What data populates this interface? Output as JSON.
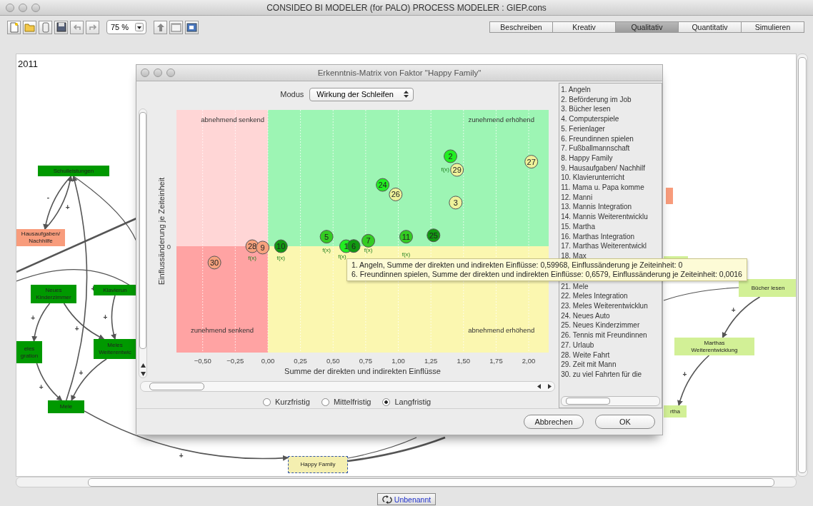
{
  "window": {
    "title": "CONSIDEO BI MODELER (for PALO) PROCESS MODELER : GIEP.cons"
  },
  "toolbar": {
    "zoom": "75 %",
    "tabs": [
      {
        "label": "Beschreiben",
        "selected": false
      },
      {
        "label": "Kreativ",
        "selected": false
      },
      {
        "label": "Qualitativ",
        "selected": true
      },
      {
        "label": "Quantitativ",
        "selected": false
      },
      {
        "label": "Simulieren",
        "selected": false
      }
    ]
  },
  "canvas": {
    "year": "2011",
    "nodes": [
      {
        "label": "Schulleistungen",
        "color": "#009900",
        "selected": false
      },
      {
        "label": "Hausaufgaben/\nNachhilfe",
        "color": "#f89c7c",
        "selected": false
      },
      {
        "label": "Neues\nKinderzimmer",
        "color": "#009900",
        "selected": false
      },
      {
        "label": "Klavierun",
        "color": "#009900",
        "selected": false
      },
      {
        "label": "eles\ngration",
        "color": "#009900",
        "selected": false
      },
      {
        "label": "Meles\nWeiterentwic",
        "color": "#009900",
        "selected": false
      },
      {
        "label": "Mele",
        "color": "#009900",
        "selected": false
      },
      {
        "label": "Happy Family",
        "color": "#f4efb0",
        "selected": true
      },
      {
        "label": "Bücher lesen",
        "color": "#d2f096",
        "selected": false
      },
      {
        "label": "Marthas\nWeiterentwicklung",
        "color": "#d2f096",
        "selected": false
      },
      {
        "label": "rtha",
        "color": "#d2f096",
        "selected": false
      },
      {
        "color": "#f89c7c",
        "selected": false
      },
      {
        "color": "#d2f096",
        "selected": false
      }
    ],
    "edges": [
      {
        "sign": "-"
      },
      {
        "sign": "+"
      },
      {
        "sign": "+"
      },
      {
        "sign": "+"
      },
      {
        "sign": "+"
      },
      {
        "sign": "+"
      },
      {
        "sign": "+"
      },
      {
        "sign": "+"
      },
      {
        "sign": "+"
      },
      {
        "sign": "+"
      },
      {
        "sign": "+"
      }
    ]
  },
  "dialog": {
    "title": "Erkenntnis-Matrix von Faktor \"Happy Family\"",
    "mode_label": "Modus",
    "mode_value": "Wirkung der Schleifen",
    "matrix": {
      "xlabel": "Summe der direkten und indirekten Einflüsse",
      "ylabel": "Einflussänderung je Zeiteinheit",
      "y_zero_label": "0",
      "xtick_labels": [
        "−0,50",
        "−0,25",
        "0,00",
        "0,25",
        "0,50",
        "0,75",
        "1,00",
        "1,25",
        "1,50",
        "1,75",
        "2,00"
      ],
      "quadrant_labels": [
        "abnehmend senkend",
        "zunehmend erhöhend",
        "zunehmend senkend",
        "abnehmend erhöhend"
      ],
      "points": [
        {
          "label": "30",
          "color": "#f7a27e"
        },
        {
          "label": "28",
          "color": "#f7a27e"
        },
        {
          "label": "9",
          "color": "#f7a27e"
        },
        {
          "label": "10",
          "color": "#119911"
        },
        {
          "label": "5",
          "color": "#33cc22"
        },
        {
          "label": "1",
          "color": "#22ee22"
        },
        {
          "label": "6",
          "color": "#119911"
        },
        {
          "label": "7",
          "color": "#33cc22"
        },
        {
          "label": "11",
          "color": "#33cc22"
        },
        {
          "label": "25",
          "color": "#119911"
        },
        {
          "label": "24",
          "color": "#22ee22"
        },
        {
          "label": "26",
          "color": "#eef29a"
        },
        {
          "label": "3",
          "color": "#eef29a"
        },
        {
          "label": "2",
          "color": "#22ee22"
        },
        {
          "label": "29",
          "color": "#eef29a"
        },
        {
          "label": "27",
          "color": "#eef29a"
        }
      ],
      "formula_marks": [
        "f(x)",
        "f(x)",
        "f(x)",
        "f(x)",
        "f(x)",
        "f(x)",
        "f(x)"
      ]
    },
    "horizon_options": [
      {
        "label": "Kurzfristig",
        "selected": false
      },
      {
        "label": "Mittelfristig",
        "selected": false
      },
      {
        "label": "Langfristig",
        "selected": true
      }
    ],
    "factor_list": [
      "1. Angeln",
      "2. Beförderung im Job",
      "3. Bücher lesen",
      "4. Computerspiele",
      "5. Ferienlager",
      "6. Freundinnen spielen",
      "7. Fußballmannschaft",
      "8. Happy Family",
      "9. Hausaufgaben/ Nachhilf",
      "10. Klavierunterricht",
      "11. Mama u. Papa komme",
      "12. Manni",
      "13. Mannis Integration",
      "14. Mannis Weiterentwicklu",
      "15. Martha",
      "16. Marthas Integration",
      "17. Marthas Weiterentwickl",
      "18. Max"
    ],
    "factor_list_after_tooltip": [
      "21. Mele",
      "22. Meles Integration",
      "23. Meles Weiterentwicklun",
      "24. Neues Auto",
      "25. Neues Kinderzimmer",
      "26. Tennis mit Freundinnen",
      "27. Urlaub",
      "28. Weite Fahrt",
      "29. Zeit mit Mann",
      "30. zu viel Fahrten für die"
    ],
    "buttons": [
      "Abbrechen",
      "OK"
    ]
  },
  "tooltip": {
    "lines": [
      "1. Angeln, Summe der direkten und indirekten Einflüsse: 0,59968, Einflussänderung je Zeiteinheit: 0",
      "6. Freundinnen spielen, Summe der direkten und indirekten Einflüsse: 0,6579, Einflussänderung je Zeiteinheit: 0,0016"
    ]
  },
  "status": {
    "document": "Unbenannt"
  }
}
